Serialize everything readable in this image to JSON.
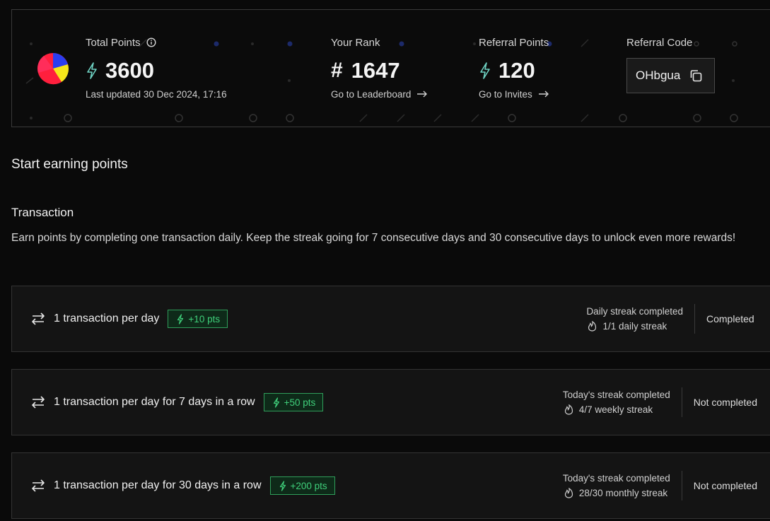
{
  "stats": {
    "total_points": {
      "label": "Total Points",
      "value": "3600",
      "updated": "Last updated 30 Dec 2024, 17:16"
    },
    "rank": {
      "label": "Your Rank",
      "prefix": "#",
      "value": "1647",
      "link": "Go to Leaderboard"
    },
    "referral_points": {
      "label": "Referral Points",
      "value": "120",
      "link": "Go to Invites"
    },
    "referral_code": {
      "label": "Referral Code",
      "value": "OHbgua"
    }
  },
  "section": {
    "title": "Start earning points",
    "subtitle": "Transaction",
    "description": "Earn points by completing one transaction daily. Keep the streak going for 7 consecutive days and 30 consecutive days to unlock even more rewards!"
  },
  "tasks": [
    {
      "label": "1 transaction per day",
      "points": "+10 pts",
      "streak_title": "Daily streak completed",
      "streak_count": "1/1 daily streak",
      "status": "Completed"
    },
    {
      "label": "1 transaction per day for 7 days in a row",
      "points": "+50 pts",
      "streak_title": "Today's streak completed",
      "streak_count": "4/7 weekly streak",
      "status": "Not completed"
    },
    {
      "label": "1 transaction per day for 30 days in a row",
      "points": "+200 pts",
      "streak_title": "Today's streak completed",
      "streak_count": "28/30 monthly streak",
      "status": "Not completed"
    }
  ],
  "icons": {
    "bolt": "lightning-bolt-icon",
    "swap": "swap-arrows-icon",
    "fire": "flame-icon",
    "copy": "copy-icon",
    "info": "info-icon",
    "arrow": "arrow-right-icon"
  },
  "colors": {
    "accent_green": "#3fcf7a",
    "bolt_teal": "#6fd3c4",
    "avatar_red": "#ff1f3d",
    "avatar_blue": "#2b3df0",
    "avatar_yellow": "#f5e61a"
  }
}
